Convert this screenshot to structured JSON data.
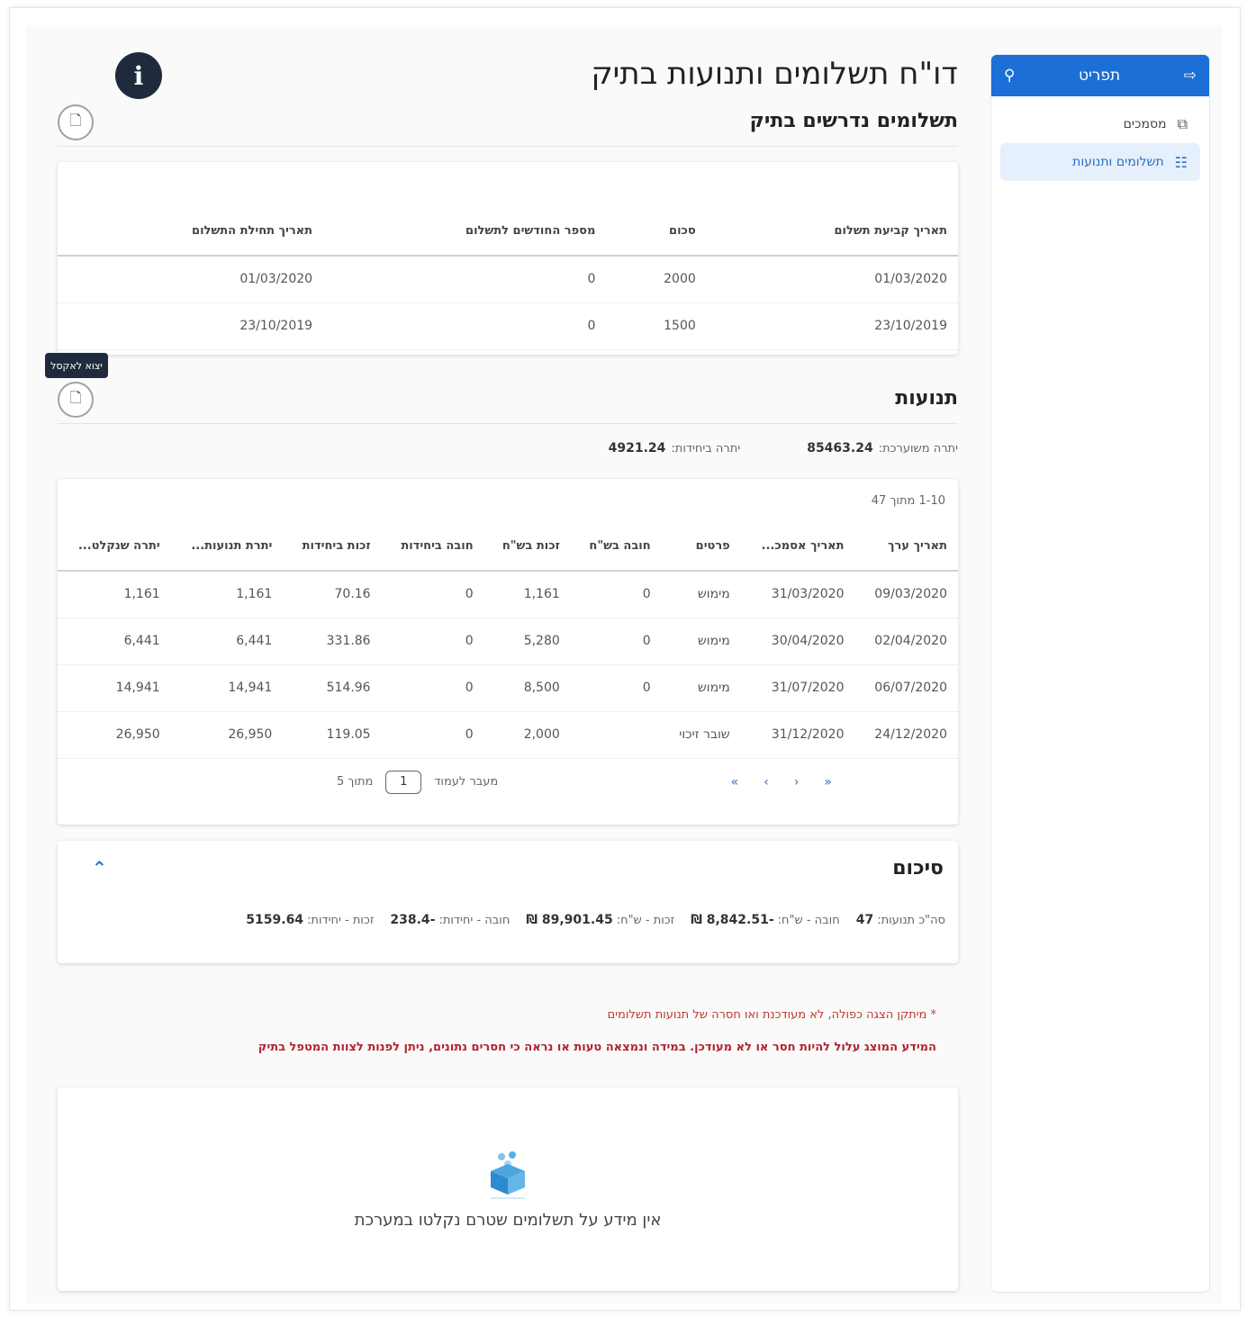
{
  "sidebar": {
    "header_label": "תפריט",
    "items": [
      {
        "label": "מסמכים",
        "icon": "copy-icon",
        "active": false
      },
      {
        "label": "תשלומים ותנועות",
        "icon": "clipboard-icon",
        "active": true
      }
    ]
  },
  "page": {
    "title": "דו\"ח תשלומים ותנועות בתיק",
    "info_glyph": "i"
  },
  "required_payments": {
    "title": "תשלומים נדרשים בתיק",
    "columns": [
      "תאריך קביעת תשלום",
      "סכום",
      "מספר החודשים לתשלום",
      "תאריך תחילת התשלום"
    ],
    "rows": [
      [
        "01/03/2020",
        "2000",
        "0",
        "01/03/2020"
      ],
      [
        "23/10/2019",
        "1500",
        "0",
        "23/10/2019"
      ]
    ]
  },
  "tooltip": {
    "text": "יצוא לאקסל"
  },
  "movements": {
    "title": "תנועות",
    "balance_label": "יתרה משוערכת:",
    "balance_value": "85463.24",
    "units_balance_label": "יתרה ביחידות:",
    "units_balance_value": "4921.24",
    "range_text": "1-10 מתוך 47",
    "columns": [
      "תאריך ערך",
      "תאריך אסמכ...",
      "פרטים",
      "חובה בש\"ח",
      "זכות בש\"ח",
      "חובה ביחידות",
      "זכות ביחידות",
      "יתרת תנועות...",
      "יתרה שנקלט..."
    ],
    "rows": [
      [
        "09/03/2020",
        "31/03/2020",
        "מימוש",
        "0",
        "1,161",
        "0",
        "70.16",
        "1,161",
        "1,161"
      ],
      [
        "02/04/2020",
        "30/04/2020",
        "מימוש",
        "0",
        "5,280",
        "0",
        "331.86",
        "6,441",
        "6,441"
      ],
      [
        "06/07/2020",
        "31/07/2020",
        "מימוש",
        "0",
        "8,500",
        "0",
        "514.96",
        "14,941",
        "14,941"
      ],
      [
        "24/12/2020",
        "31/12/2020",
        "שובר זיכוי",
        "",
        "2,000",
        "0",
        "119.05",
        "26,950",
        "26,950"
      ]
    ],
    "pager": {
      "first": "«",
      "prev": "‹",
      "next": "›",
      "last": "»",
      "goto_label": "מעבר לעמוד",
      "page_value": "1",
      "of_label": "מתוך 5"
    }
  },
  "summary": {
    "title": "סיכום",
    "items": [
      {
        "label": "סה\"כ תנועות:",
        "value": "47"
      },
      {
        "label": "חובה - ש\"ח:",
        "value": "-8,842.51 ₪"
      },
      {
        "label": "זכות - ש\"ח:",
        "value": "89,901.45 ₪"
      },
      {
        "label": "חובה - יחידות:",
        "value": "-238.4"
      },
      {
        "label": "זכות - יחידות:",
        "value": "5159.64"
      }
    ]
  },
  "notes": {
    "line1": "* מיתקן הצגה כפולה, לא מעודכנת ואו חסרה של תנועות תשלומים",
    "line2": "המידע המוצג עלול להיות חסר או לא מעודכן. במידה ונמצאה טעות או נראה כי חסרים נתונים, ניתן לפנות לצוות המטפל בתיק"
  },
  "empty_state": {
    "text": "אין מידע על תשלומים שטרם נקלטו במערכת"
  },
  "colors": {
    "primary": "#1c6fd6",
    "error": "#c0392b",
    "dark": "#1f2b3d"
  }
}
